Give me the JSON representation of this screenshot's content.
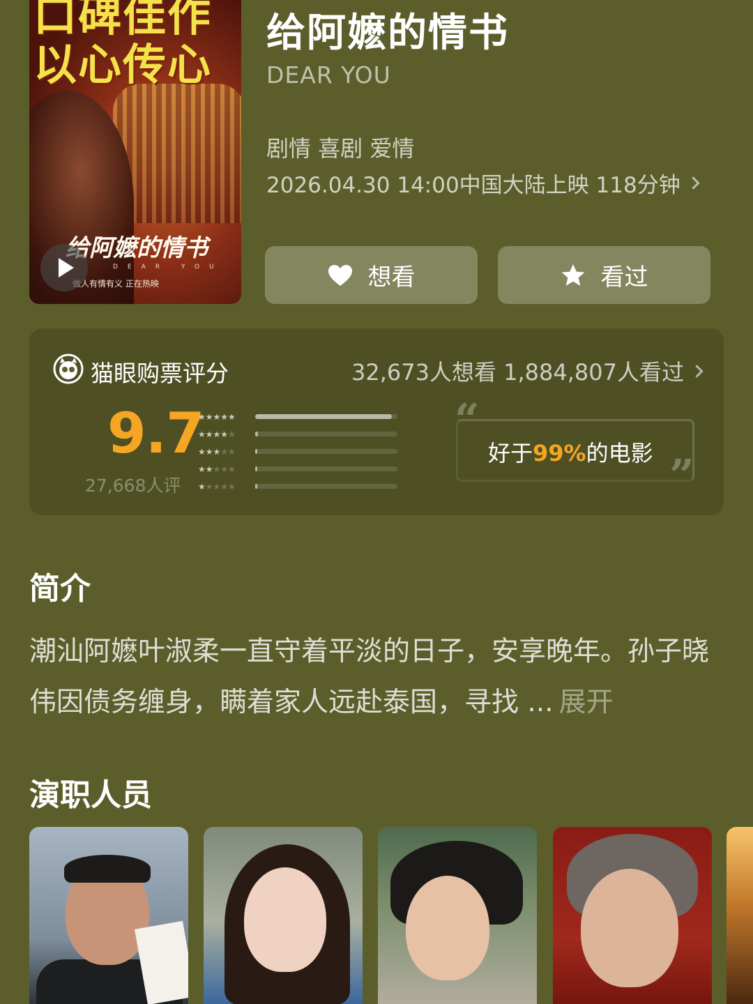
{
  "poster": {
    "headline_line1": "口碑佳作",
    "headline_line2": "以心传心",
    "poster_title": "给阿嬷的情书",
    "poster_en": "DEAR YOU",
    "tagline": "做人有情有义  正在热映"
  },
  "movie": {
    "title": "给阿嬷的情书",
    "english_title": "DEAR YOU",
    "genres": "剧情 喜剧 爱情",
    "release_info": "2026.04.30 14:00中国大陆上映 118分钟"
  },
  "actions": {
    "want_label": "想看",
    "seen_label": "看过"
  },
  "rating": {
    "label": "猫眼购票评分",
    "counts": "32,673人想看 1,884,807人看过",
    "score": "9.7",
    "voters": "27,668人评",
    "distribution": [
      0.96,
      0.02,
      0.01,
      0.005,
      0.005
    ],
    "better_prefix": "好于",
    "better_pct": "99%",
    "better_suffix": "的电影"
  },
  "synopsis": {
    "title": "简介",
    "text": "潮汕阿嬷叶淑柔一直守着平淡的日子，安享晚年。孙子晓伟因债务缠身，瞒着家人远赴泰国，寻找 ...",
    "expand_label": "展开"
  },
  "cast": {
    "title": "演职人员"
  },
  "colors": {
    "background": "#5b5e2b",
    "accent": "#f6a623"
  }
}
